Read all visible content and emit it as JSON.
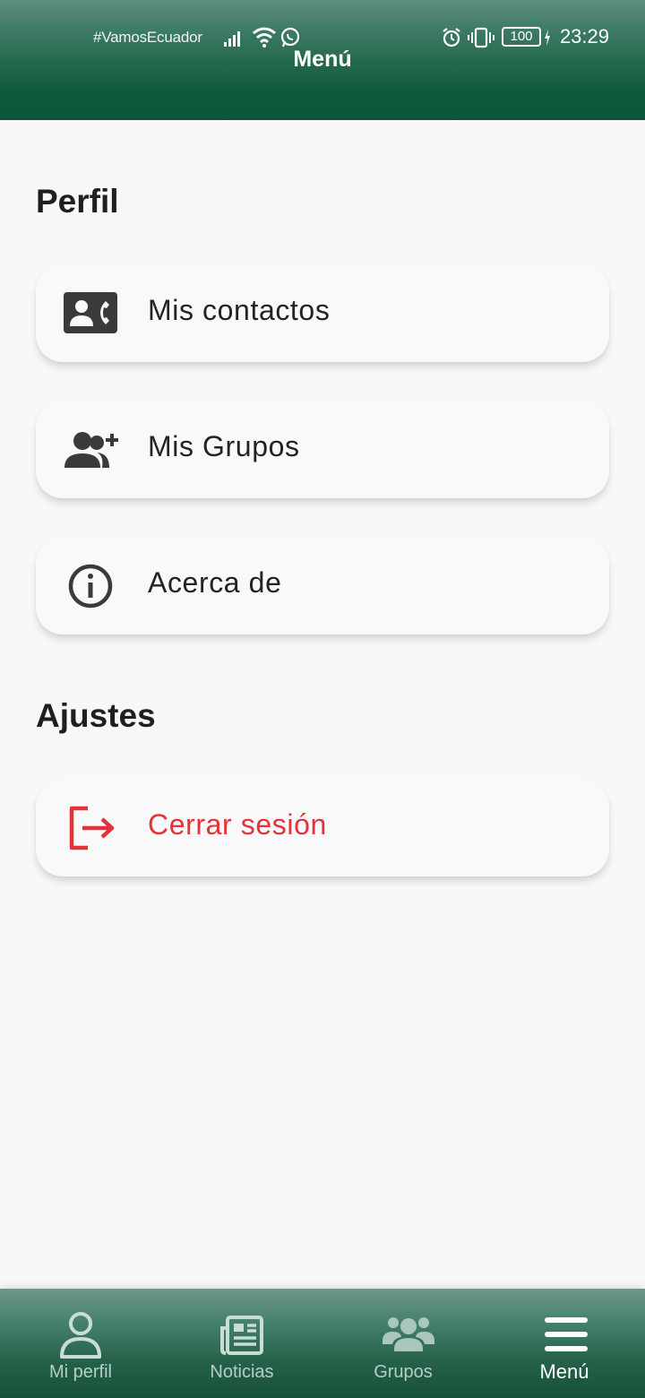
{
  "status_bar": {
    "carrier": "#VamosEcuador",
    "battery": "100",
    "time": "23:29"
  },
  "header": {
    "title": "Menú"
  },
  "sections": {
    "profile": {
      "heading": "Perfil",
      "items": [
        {
          "label": "Mis contactos",
          "icon": "contact-phone-icon"
        },
        {
          "label": "Mis Grupos",
          "icon": "group-add-icon"
        },
        {
          "label": "Acerca de",
          "icon": "info-icon"
        }
      ]
    },
    "settings": {
      "heading": "Ajustes",
      "items": [
        {
          "label": "Cerrar sesión",
          "icon": "logout-icon"
        }
      ]
    }
  },
  "bottom_nav": {
    "items": [
      {
        "label": "Mi perfil",
        "icon": "person-icon",
        "active": false
      },
      {
        "label": "Noticias",
        "icon": "newspaper-icon",
        "active": false
      },
      {
        "label": "Grupos",
        "icon": "groups-icon",
        "active": false
      },
      {
        "label": "Menú",
        "icon": "menu-icon",
        "active": true
      }
    ]
  },
  "colors": {
    "header_green": "#0b5537",
    "logout_red": "#e3323a",
    "icon_dark": "#3a3a3a",
    "nav_active": "#ffffff"
  }
}
